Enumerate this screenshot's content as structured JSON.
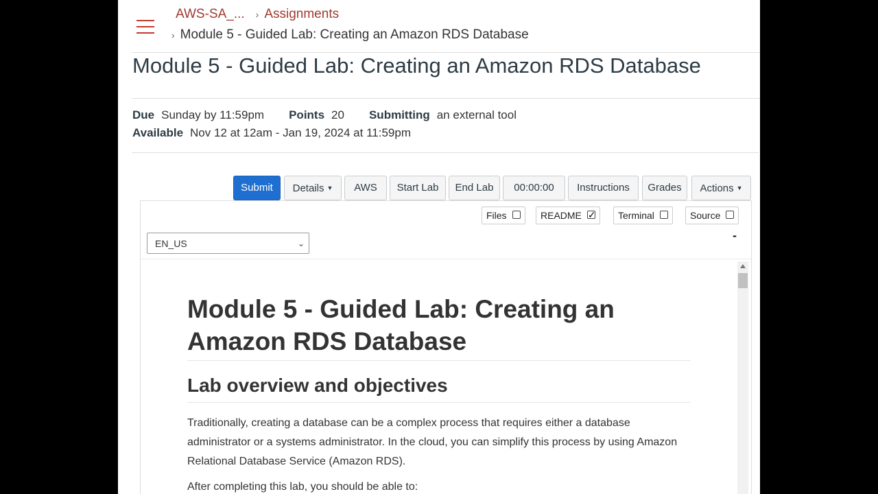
{
  "breadcrumb": {
    "course": "AWS-SA_...",
    "assignments": "Assignments",
    "current": "Module 5 - Guided Lab: Creating an Amazon RDS Database",
    "separator": "›"
  },
  "page": {
    "title": "Module 5 - Guided Lab: Creating an Amazon RDS Database"
  },
  "meta": {
    "due_label": "Due",
    "due_value": "Sunday by 11:59pm",
    "points_label": "Points",
    "points_value": "20",
    "submitting_label": "Submitting",
    "submitting_value": "an external tool",
    "available_label": "Available",
    "available_value": "Nov 12 at 12am - Jan 19, 2024 at 11:59pm"
  },
  "toolbar": {
    "submit": "Submit",
    "details": "Details",
    "aws": "AWS",
    "start_lab": "Start Lab",
    "end_lab": "End Lab",
    "timer": "00:00:00",
    "instructions": "Instructions",
    "grades": "Grades",
    "actions": "Actions"
  },
  "panel_toggles": {
    "files": {
      "label": "Files",
      "checked": false
    },
    "readme": {
      "label": "README",
      "checked": true
    },
    "terminal": {
      "label": "Terminal",
      "checked": false
    },
    "source": {
      "label": "Source",
      "checked": false
    }
  },
  "language_select": {
    "value": "EN_US"
  },
  "collapse_label": "-",
  "document": {
    "h1": "Module 5 - Guided Lab: Creating an Amazon RDS Database",
    "h2": "Lab overview and objectives",
    "p1": "Traditionally, creating a database can be a complex process that requires either a database administrator or a systems administrator. In the cloud, you can simplify this process by using Amazon Relational Database Service (Amazon RDS).",
    "p2": "After completing this lab, you should be able to:"
  },
  "colors": {
    "accent_link": "#a03a2e",
    "hamburger": "#c4372b",
    "primary_button": "#1f6fd1"
  }
}
